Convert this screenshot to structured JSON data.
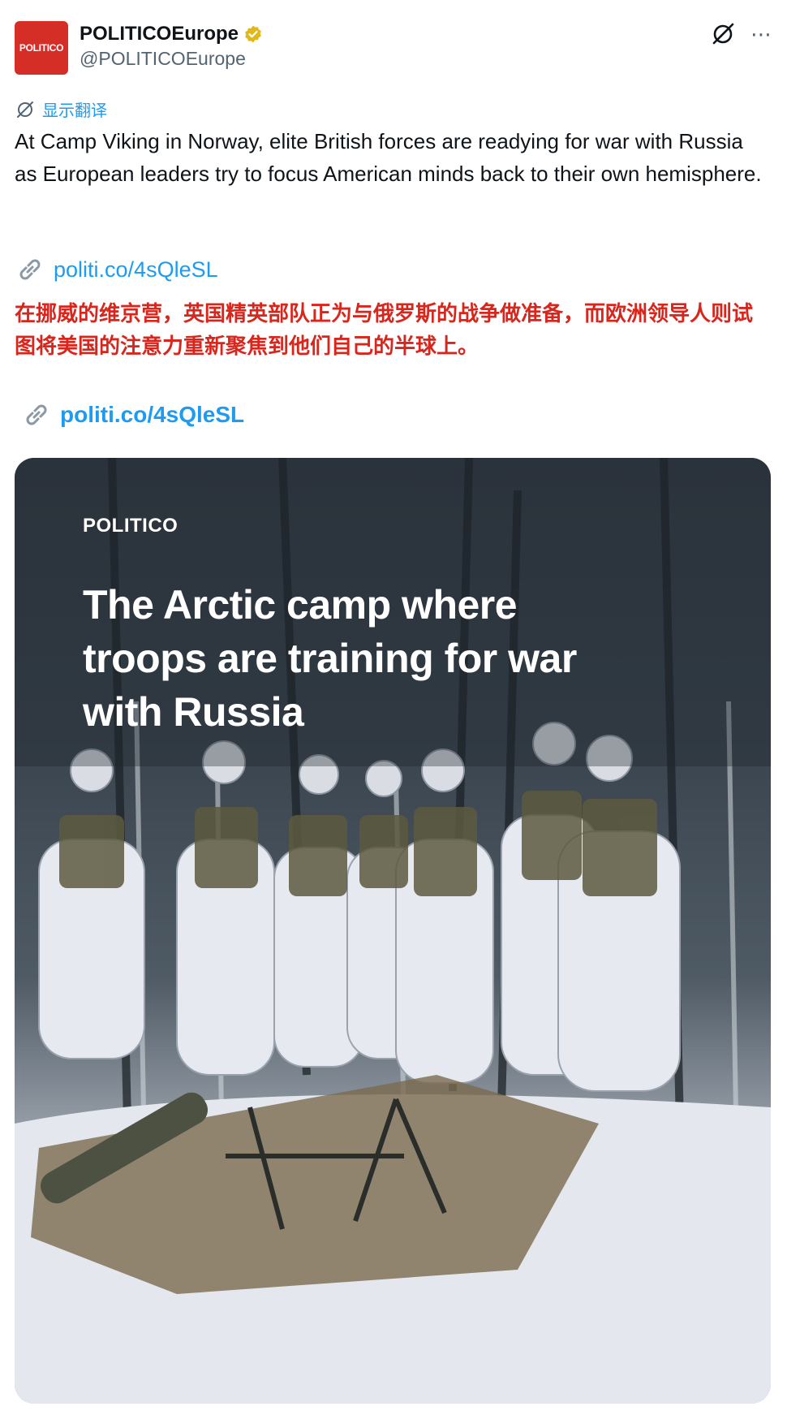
{
  "account": {
    "avatar_text": "POLITICO",
    "display_name": "POLITICOEurope",
    "handle": "@POLITICOEurope"
  },
  "translate_label": "显示翻译",
  "tweet_text": "At Camp Viking in Norway, elite British forces are readying for war with Russia as European leaders try to focus American minds back to their own hemisphere.",
  "link_text": "politi.co/4sQleSL",
  "translation_text": "在挪威的维京营，英国精英部队正为与俄罗斯的战争做准备，而欧洲领导人则试图将美国的注意力重新聚焦到他们自己的半球上。",
  "link_text_2": "politi.co/4sQleSL",
  "media": {
    "brand": "POLITICO",
    "headline": "The Arctic camp where troops are training for war with Russia"
  },
  "icons": {
    "more": "more-options-icon",
    "grok": "grok-icon",
    "verified": "verified-badge-icon",
    "link": "link-icon"
  },
  "colors": {
    "accent": "#1d9bf0",
    "brand_red": "#d42e27",
    "translation_red": "#d8261d"
  }
}
